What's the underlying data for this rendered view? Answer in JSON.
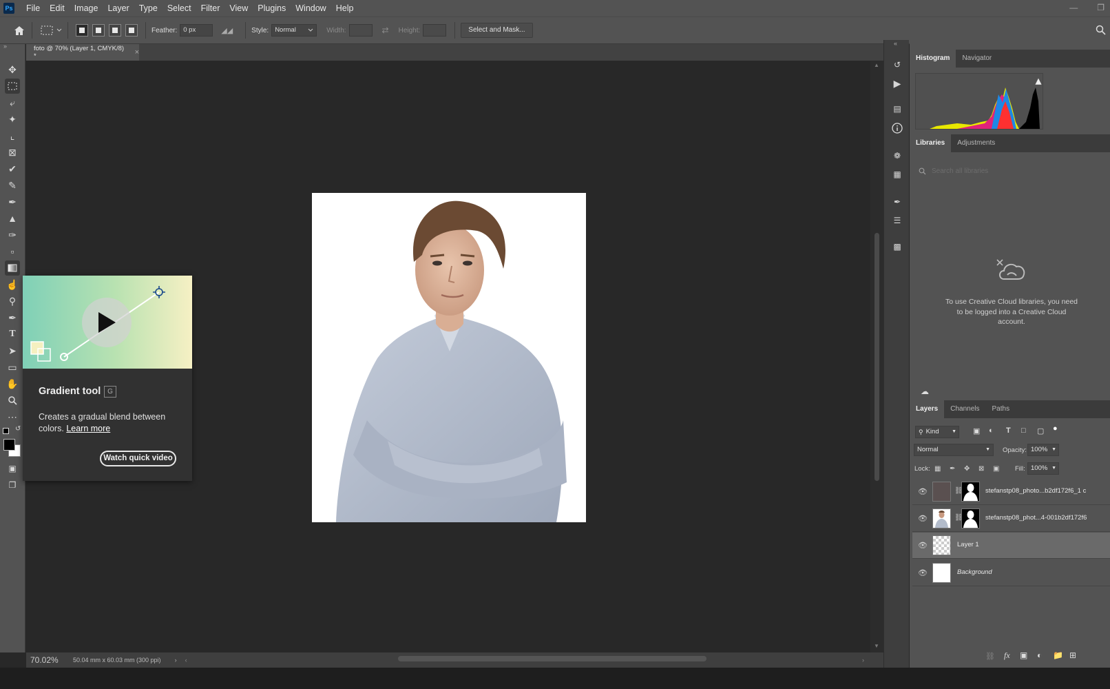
{
  "app": {
    "logo": "Ps"
  },
  "menu": [
    "File",
    "Edit",
    "Image",
    "Layer",
    "Type",
    "Select",
    "Filter",
    "View",
    "Plugins",
    "Window",
    "Help"
  ],
  "options_bar": {
    "feather_label": "Feather:",
    "feather_value": "0 px",
    "style_label": "Style:",
    "style_value": "Normal",
    "width_label": "Width:",
    "height_label": "Height:",
    "select_mask_label": "Select and Mask..."
  },
  "document": {
    "tab_title": "foto @ 70% (Layer 1, CMYK/8) *",
    "zoom": "70.02%",
    "doc_info": "50.04 mm x 60.03 mm (300 ppi)"
  },
  "tooltip": {
    "title": "Gradient tool",
    "shortcut": "G",
    "description": "Creates a gradual blend between colors.",
    "learn_more": "Learn more",
    "watch_video": "Watch quick video"
  },
  "panels": {
    "top_tabs": [
      "Histogram",
      "Navigator"
    ],
    "lib_tabs": [
      "Libraries",
      "Adjustments"
    ],
    "lib_search_placeholder": "Search all libraries",
    "lib_message": "To use Creative Cloud libraries, you need to be logged into a Creative Cloud account.",
    "layer_tabs": [
      "Layers",
      "Channels",
      "Paths"
    ]
  },
  "layers_panel": {
    "kind_label": "Kind",
    "blend_mode": "Normal",
    "opacity_label": "Opacity:",
    "opacity_value": "100%",
    "lock_label": "Lock:",
    "fill_label": "Fill:",
    "fill_value": "100%",
    "layers": [
      {
        "name": "stefanstp08_photo...b2df172f6_1 c"
      },
      {
        "name": "stefanstp08_phot...4-001b2df172f6"
      },
      {
        "name": "Layer 1"
      },
      {
        "name": "Background"
      }
    ]
  },
  "colors": {
    "accent": "#31a8ff",
    "foreground": "#000000",
    "background": "#ffffff",
    "gradient_start": "#7fd0b7",
    "gradient_end": "#f6f0c4"
  }
}
